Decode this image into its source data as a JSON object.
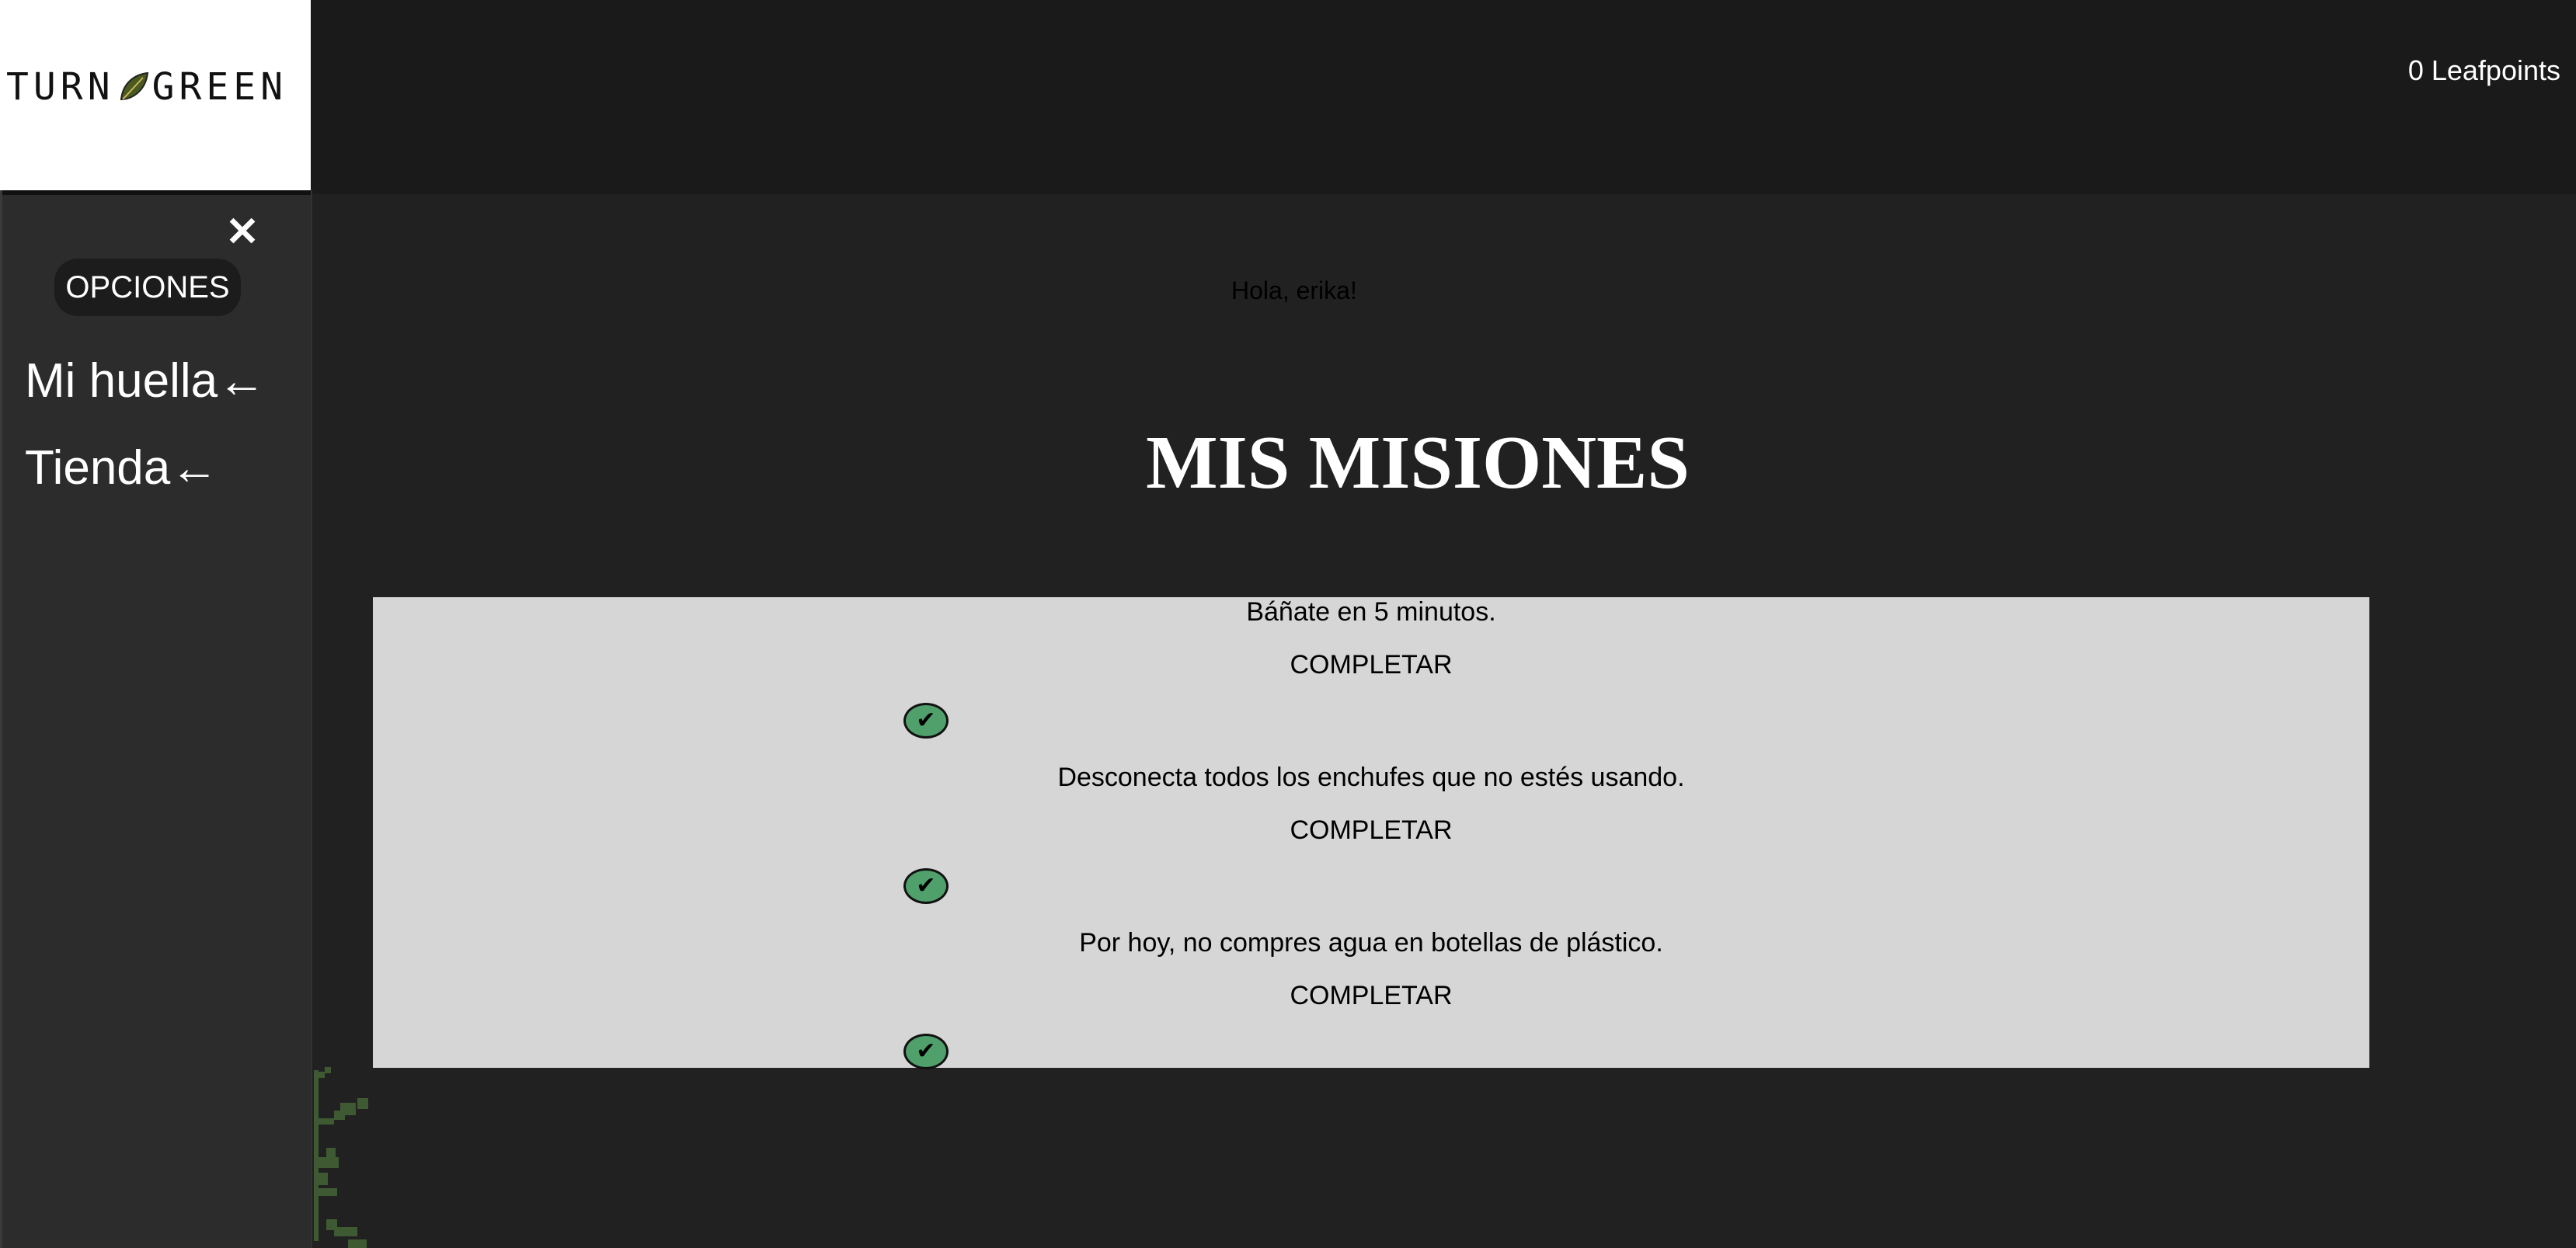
{
  "header": {
    "logo_text_left": "TURN",
    "logo_text_right": "GREEN",
    "leafpoints": "0 Leafpoints"
  },
  "sidebar": {
    "close_icon": "close-icon",
    "options_label": "OPCIONES",
    "items": [
      {
        "label": "Mi huella←"
      },
      {
        "label": "Tienda←"
      }
    ]
  },
  "main": {
    "greeting": "Hola, erika!",
    "title": "MIS MISIONES",
    "missions": [
      {
        "text": "Báñate en 5 minutos.",
        "action": "COMPLETAR",
        "check_icon": "check-icon"
      },
      {
        "text": "Desconecta todos los enchufes que no estés usando.",
        "action": "COMPLETAR",
        "check_icon": "check-icon"
      },
      {
        "text": "Por hoy, no compres agua en botellas de plástico.",
        "action": "COMPLETAR",
        "check_icon": "check-icon"
      }
    ]
  },
  "colors": {
    "background": "#212121",
    "topbar": "#1b1a1b",
    "sidebar": "#2c2c2c",
    "panel": "#d6d6d6",
    "check_green": "#4fa06b"
  }
}
